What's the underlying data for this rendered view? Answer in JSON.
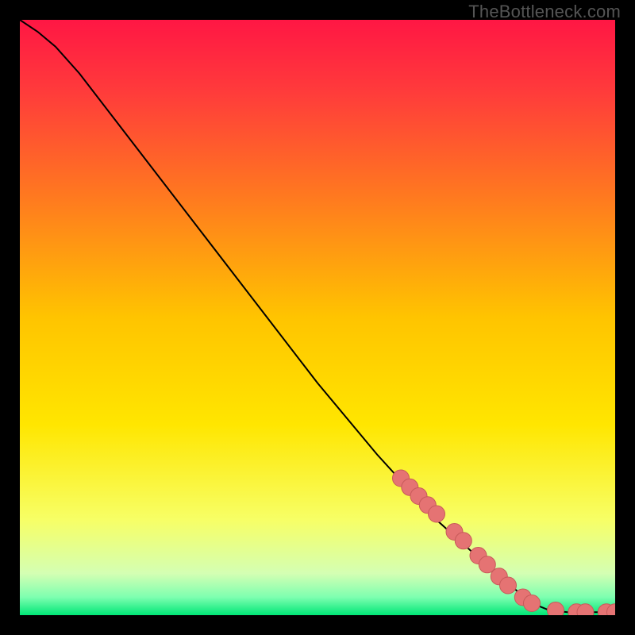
{
  "brand": "TheBottleneck.com",
  "colors": {
    "marker_fill": "#e57373",
    "marker_stroke": "#c75a5a",
    "curve": "#000000",
    "gradient": [
      "#ff1744",
      "#ff3b3b",
      "#ff7a1f",
      "#ffc400",
      "#ffe600",
      "#f7ff66",
      "#d4ffb3",
      "#7dffb0",
      "#00e676"
    ]
  },
  "chart_data": {
    "type": "line",
    "title": "",
    "xlabel": "",
    "ylabel": "",
    "xlim": [
      0,
      100
    ],
    "ylim": [
      0,
      100
    ],
    "curve": [
      {
        "x": 0,
        "y": 100
      },
      {
        "x": 3,
        "y": 98
      },
      {
        "x": 6,
        "y": 95.5
      },
      {
        "x": 10,
        "y": 91
      },
      {
        "x": 20,
        "y": 78
      },
      {
        "x": 30,
        "y": 65
      },
      {
        "x": 40,
        "y": 52
      },
      {
        "x": 50,
        "y": 39
      },
      {
        "x": 60,
        "y": 27
      },
      {
        "x": 70,
        "y": 16
      },
      {
        "x": 80,
        "y": 7
      },
      {
        "x": 86,
        "y": 2
      },
      {
        "x": 89,
        "y": 0.8
      },
      {
        "x": 92,
        "y": 0.5
      },
      {
        "x": 96,
        "y": 0.5
      },
      {
        "x": 100,
        "y": 0.5
      }
    ],
    "markers": [
      {
        "x": 64,
        "y": 23
      },
      {
        "x": 65.5,
        "y": 21.5
      },
      {
        "x": 67,
        "y": 20
      },
      {
        "x": 68.5,
        "y": 18.5
      },
      {
        "x": 70,
        "y": 17
      },
      {
        "x": 73,
        "y": 14
      },
      {
        "x": 74.5,
        "y": 12.5
      },
      {
        "x": 77,
        "y": 10
      },
      {
        "x": 78.5,
        "y": 8.5
      },
      {
        "x": 80.5,
        "y": 6.5
      },
      {
        "x": 82,
        "y": 5
      },
      {
        "x": 84.5,
        "y": 3
      },
      {
        "x": 86,
        "y": 2
      },
      {
        "x": 90,
        "y": 0.8
      },
      {
        "x": 93.5,
        "y": 0.5
      },
      {
        "x": 95,
        "y": 0.5
      },
      {
        "x": 98.5,
        "y": 0.5
      },
      {
        "x": 100,
        "y": 0.5
      }
    ],
    "marker_radius_data_units": 1.4
  }
}
